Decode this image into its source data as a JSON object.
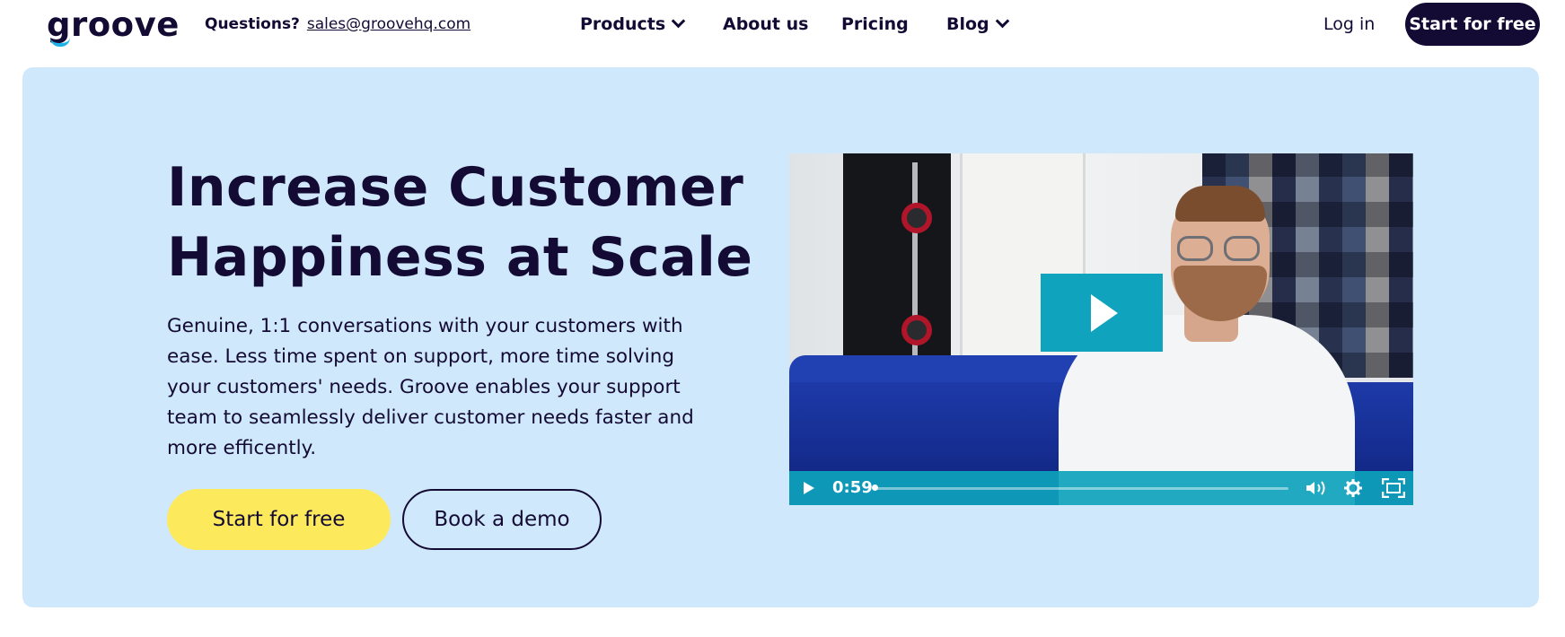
{
  "header": {
    "logo": "groove",
    "questions_label": "Questions?",
    "questions_email": "sales@groovehq.com",
    "nav": {
      "products": "Products",
      "about": "About us",
      "pricing": "Pricing",
      "blog": "Blog"
    },
    "login": "Log in",
    "cta": "Start for free"
  },
  "hero": {
    "title_line1": "Increase Customer",
    "title_line2": "Happiness at Scale",
    "description": "Genuine, 1:1 conversations with your customers with ease. Less time spent on support, more time solving your customers' needs. Groove enables your support team to seamlessly deliver customer needs faster and more efficently.",
    "primary_button": "Start for free",
    "secondary_button": "Book a demo"
  },
  "video": {
    "time": "0:59",
    "icons": [
      "play-icon",
      "volume-icon",
      "settings-icon",
      "fullscreen-icon"
    ]
  },
  "colors": {
    "brand_dark": "#140b34",
    "hero_bg": "#cfe8fc",
    "cta_yellow": "#fdea5c",
    "video_accent": "#0fa3bd",
    "logo_accent": "#1fb2e8"
  }
}
